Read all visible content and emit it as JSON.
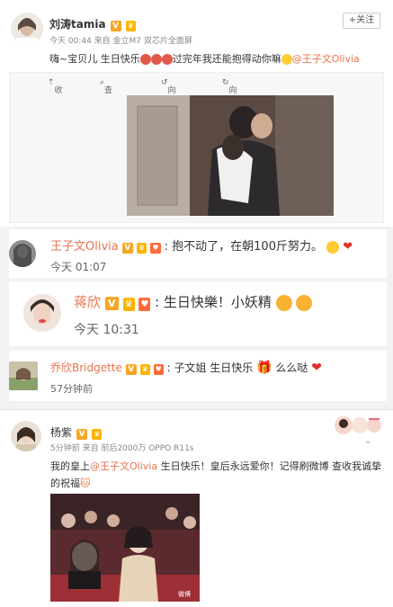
{
  "post1": {
    "name": "刘涛tamia",
    "meta": "今天 00:44 来自 金立M7 双芯片全面屏",
    "text_prefix": "嗨~宝贝儿 生日快乐",
    "text_suffix": "过完年我还能抱得动你嘛",
    "mention": "@王子文Olivia",
    "follow_label": "+关注",
    "toolbar": {
      "collapse": "收起",
      "view_large": "查看大图",
      "rotate_left": "向左旋转",
      "rotate_right": "向右旋转"
    }
  },
  "comments": [
    {
      "name": "王子文Olivia",
      "text": "抱不动了，在朝100斤努力。",
      "time": "今天 01:07"
    },
    {
      "name": "蒋欣",
      "text": "生日快樂！小妖精",
      "time": "今天 10:31"
    },
    {
      "name": "乔欣Bridgette",
      "text_a": "子文姐 生日快乐",
      "text_b": "么么哒",
      "time": "57分钟前"
    }
  ],
  "post2": {
    "name": "杨紫",
    "meta": "5分钟前 来自 前后2000万 OPPO R11s",
    "text_prefix": "我的皇上",
    "mention": "@王子文Olivia",
    "text_suffix": " 生日快乐！皇后永远爱你！记得刷微博 查收我诚挚的祝福",
    "watermark": "微博"
  },
  "colors": {
    "accent": "#eb7350",
    "vip": "#f5a623",
    "text": "#333333",
    "meta": "#888888"
  }
}
